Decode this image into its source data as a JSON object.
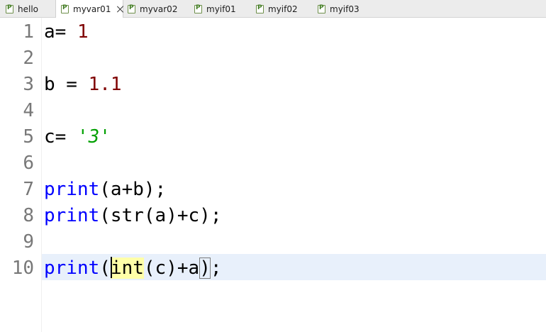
{
  "tabs": [
    {
      "label": "hello",
      "active": false,
      "icon": "python-file-icon"
    },
    {
      "label": "myvar01",
      "active": true,
      "icon": "python-file-icon"
    },
    {
      "label": "myvar02",
      "active": false,
      "icon": "python-file-icon"
    },
    {
      "label": "myif01",
      "active": false,
      "icon": "python-file-icon"
    },
    {
      "label": "myif02",
      "active": false,
      "icon": "python-file-icon"
    },
    {
      "label": "myif03",
      "active": false,
      "icon": "python-file-icon"
    }
  ],
  "editor": {
    "colors": {
      "keyword": "#0000ff",
      "number": "#7f0000",
      "string": "#00a000",
      "current_line": "#e8f0fb",
      "occurrence_highlight": "#ffffa8"
    },
    "lines": [
      {
        "no": "1",
        "tokens": [
          {
            "t": "a= ",
            "k": "plain"
          },
          {
            "t": "1",
            "k": "num"
          }
        ]
      },
      {
        "no": "2",
        "tokens": []
      },
      {
        "no": "3",
        "tokens": [
          {
            "t": "b = ",
            "k": "plain"
          },
          {
            "t": "1.1",
            "k": "num"
          }
        ]
      },
      {
        "no": "4",
        "tokens": []
      },
      {
        "no": "5",
        "tokens": [
          {
            "t": "c= ",
            "k": "plain"
          },
          {
            "t": "'3'",
            "k": "str"
          }
        ]
      },
      {
        "no": "6",
        "tokens": []
      },
      {
        "no": "7",
        "tokens": [
          {
            "t": "print",
            "k": "kw"
          },
          {
            "t": "(a+b);",
            "k": "plain"
          }
        ]
      },
      {
        "no": "8",
        "tokens": [
          {
            "t": "print",
            "k": "kw"
          },
          {
            "t": "(str(a)+c);",
            "k": "plain"
          }
        ]
      },
      {
        "no": "9",
        "tokens": []
      },
      {
        "no": "10",
        "tokens": [
          {
            "t": "print",
            "k": "kw"
          },
          {
            "t": "(",
            "k": "plain"
          },
          {
            "t": "",
            "k": "caret"
          },
          {
            "t": "int",
            "k": "hl"
          },
          {
            "t": "(c)+a",
            "k": "plain"
          },
          {
            "t": ")",
            "k": "bracket"
          },
          {
            "t": ";",
            "k": "plain"
          }
        ]
      }
    ]
  }
}
